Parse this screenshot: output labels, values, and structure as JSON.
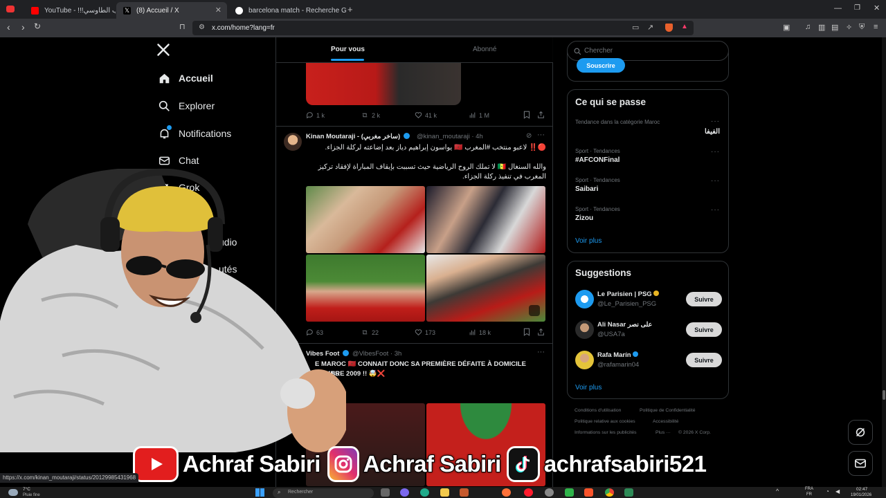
{
  "browser": {
    "tabs": [
      {
        "title": "YouTube - !!!لما يغضب الطاوسي",
        "active": false,
        "favicon_color": "#ff0000"
      },
      {
        "title": "(8) Accueil / X",
        "active": true,
        "favicon_color": "#000000"
      },
      {
        "title": "barcelona match - Recherche Google",
        "active": false,
        "favicon_color": "#4285f4"
      }
    ],
    "new_tab": "+",
    "url": "x.com/home?lang=fr"
  },
  "nav": {
    "items": [
      {
        "label": "Accueil",
        "icon": "home-icon"
      },
      {
        "label": "Explorer",
        "icon": "search-icon"
      },
      {
        "label": "Notifications",
        "icon": "bell-icon"
      },
      {
        "label": "Chat",
        "icon": "mail-icon"
      },
      {
        "label": "Grok",
        "icon": "grok-icon"
      },
      {
        "label": "udio",
        "icon": "studio-icon"
      },
      {
        "label": "utés",
        "icon": "communities-icon"
      }
    ]
  },
  "timeline": {
    "tabs": [
      {
        "label": "Pour vous",
        "active": true
      },
      {
        "label": "Abonné",
        "active": false
      }
    ],
    "prev_tweet_stats": {
      "replies": "1 k",
      "reposts": "2 k",
      "likes": "41 k",
      "views": "1 M"
    },
    "tweets": [
      {
        "name": "Kinan Moutaraji - (ساخر مغربي)",
        "handle": "@kinan_moutaraji · 4h",
        "verified": true,
        "text1": "🔴‼️ لاعبو منتخب #المغرب 🇲🇦 يواسون إبراهيم دياز بعد إضاعته لركلة الجزاء.",
        "text2": "والله السنغال 🇸🇳 لا تملك الروح الرياضية حيث تسببت بإيقاف المباراة لإفقاد تركيز المغرب في تنفيذ ركلة الجزاء.",
        "stats": {
          "replies": "63",
          "reposts": "22",
          "likes": "173",
          "views": "18 k"
        }
      },
      {
        "name": "Vibes Foot",
        "handle": "@VibesFoot · 3h",
        "verified": true,
        "text1": "E MAROC 🇲🇦 CONNAIT DONC SA PREMIÈRE DÉFAITE À DOMICILE DEPUIS",
        "text2": "LE   VEMBRE 2009 !! 🤯❌"
      }
    ]
  },
  "sidebar": {
    "search_placeholder": "Chercher",
    "subscribe_label": "Souscrire",
    "trends_title": "Ce qui se passe",
    "trends": [
      {
        "meta": "Tendance dans la catégorie Maroc",
        "name": "الفيفا"
      },
      {
        "meta": "Sport · Tendances",
        "name": "#AFCONFinal"
      },
      {
        "meta": "Sport · Tendances",
        "name": "Saibari"
      },
      {
        "meta": "Sport · Tendances",
        "name": "Zizou"
      }
    ],
    "trends_more": "Voir plus",
    "suggestions_title": "Suggestions",
    "suggestions": [
      {
        "name": "Le Parisien | PSG",
        "handle": "@Le_Parisien_PSG",
        "button": "Suivre",
        "verified": true
      },
      {
        "name": "Ali Nasar على نصر",
        "handle": "@USA7a",
        "button": "Suivre",
        "verified": false
      },
      {
        "name": "Rafa Marín",
        "handle": "@rafamarin04",
        "button": "Suivre",
        "verified": true
      }
    ],
    "suggestions_more": "Voir plus",
    "footer": [
      "Conditions d'utilisation",
      "Politique de Confidentialité",
      "Politique relative aux cookies",
      "Accessibilité",
      "Informations sur les publicités",
      "Plus ···",
      "© 2026 X Corp."
    ]
  },
  "overlay": {
    "youtube_name": "Achraf Sabiri",
    "instagram_name": "Achraf Sabiri",
    "tiktok_name": "achrafsabiri521"
  },
  "status_url": "https://x.com/kinan_moutaraji/status/20129985431968",
  "taskbar": {
    "weather_temp": "7°C",
    "weather_desc": "Pluie fine",
    "search_placeholder": "Rechercher",
    "lang": "FRA",
    "lang2": "FR",
    "time": "02:47",
    "date": "19/01/2026"
  },
  "colors": {
    "accent": "#1d9bf0",
    "background": "#000000",
    "border": "#2f3336"
  }
}
